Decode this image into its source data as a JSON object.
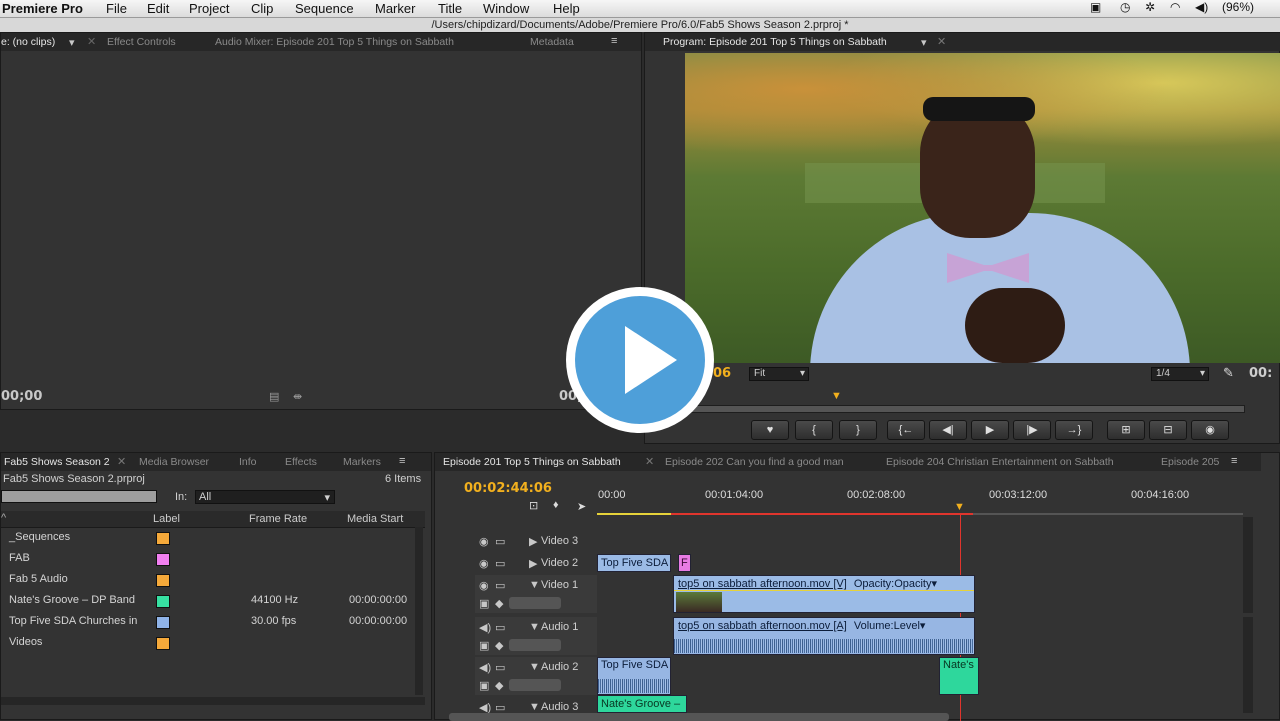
{
  "menubar": {
    "app": "Premiere Pro",
    "items": [
      "File",
      "Edit",
      "Project",
      "Clip",
      "Sequence",
      "Marker",
      "Title",
      "Window",
      "Help"
    ],
    "battery": "(96%)"
  },
  "window_title": "/Users/chipdizard/Documents/Adobe/Premiere Pro/6.0/Fab5 Shows Season 2.prproj *",
  "source_panel": {
    "tabs": [
      "e: (no clips)",
      "Effect Controls",
      "Audio Mixer: Episode 201 Top 5 Things on Sabbath",
      "Metadata"
    ],
    "timecode_left": "00;00",
    "timecode_right": "00;"
  },
  "program_panel": {
    "tab": "Program: Episode 201 Top 5 Things on Sabbath",
    "timecode_partial": "06",
    "fit": "Fit",
    "resolution": "1/4",
    "timecode_right": "00:",
    "play_overlay": "play-icon"
  },
  "project_panel": {
    "tabs": [
      "Fab5 Shows Season 2",
      "Media Browser",
      "Info",
      "Effects",
      "Markers"
    ],
    "file": "Fab5 Shows Season 2.prproj",
    "item_count": "6 Items",
    "in_label": "In:",
    "in_value": "All",
    "columns": [
      "Label",
      "Frame Rate",
      "Media Start"
    ],
    "rows": [
      {
        "name": "_Sequences",
        "color": "#f5a93a",
        "rate": "",
        "start": ""
      },
      {
        "name": "FAB",
        "color": "#f17ff0",
        "rate": "",
        "start": ""
      },
      {
        "name": "Fab 5 Audio",
        "color": "#f5a93a",
        "rate": "",
        "start": ""
      },
      {
        "name": "Nate's Groove – DP Band",
        "color": "#37e0a2",
        "rate": "44100 Hz",
        "start": "00:00:00:00"
      },
      {
        "name": "Top Five SDA Churches in",
        "color": "#8fb3e8",
        "rate": "30.00 fps",
        "start": "00:00:00:00"
      },
      {
        "name": "Videos",
        "color": "#f5a93a",
        "rate": "",
        "start": ""
      }
    ]
  },
  "timeline": {
    "tabs": [
      "Episode 201 Top 5 Things on Sabbath",
      "Episode 202 Can you find a good man",
      "Episode 204 Christian Entertainment on Sabbath",
      "Episode 205"
    ],
    "timecode": "00:02:44:06",
    "ruler": [
      "00:00",
      "00:01:04:00",
      "00:02:08:00",
      "00:03:12:00",
      "00:04:16:00"
    ],
    "tracks": [
      "Video 3",
      "Video 2",
      "Video 1",
      "Audio 1",
      "Audio 2",
      "Audio 3"
    ],
    "clips": {
      "v2_a": "Top Five SDA",
      "v2_b": "F",
      "v1": "top5 on sabbath afternoon.mov [V]",
      "v1_fx": "Opacity:Opacity",
      "a1": "top5 on sabbath afternoon.mov [A]",
      "a1_fx": "Volume:Level",
      "a2_a": "Top Five SDA",
      "a2_b": "Nate's",
      "a3": "Nate's Groove –"
    }
  }
}
